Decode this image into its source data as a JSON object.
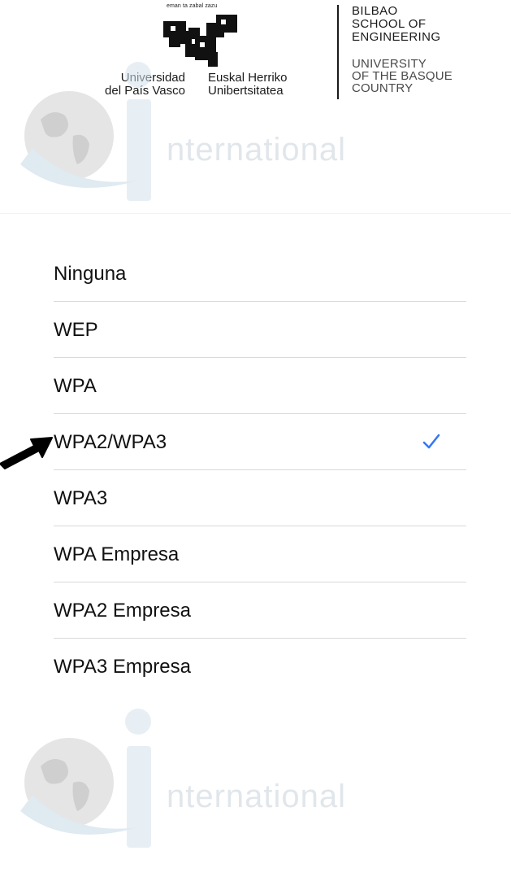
{
  "header": {
    "motto": "eman ta zabal zazu",
    "university_es": [
      "Universidad",
      "del País Vasco"
    ],
    "university_eu": [
      "Euskal Herriko",
      "Unibertsitatea"
    ],
    "school": [
      "BILBAO",
      "SCHOOL OF",
      "ENGINEERING"
    ],
    "university_en": [
      "UNIVERSITY",
      "OF THE BASQUE",
      "COUNTRY"
    ]
  },
  "watermark": {
    "word": "nternational",
    "icon": "globe-icon"
  },
  "security_options": {
    "items": [
      {
        "label": "Ninguna"
      },
      {
        "label": "WEP"
      },
      {
        "label": "WPA"
      },
      {
        "label": "WPA2/WPA3",
        "selected": true
      },
      {
        "label": "WPA3"
      },
      {
        "label": "WPA Empresa"
      },
      {
        "label": "WPA2 Empresa"
      },
      {
        "label": "WPA3 Empresa"
      }
    ],
    "selected_icon": "checkmark-icon",
    "selected_color": "#3478f6"
  },
  "annotation": {
    "icon": "arrow-icon",
    "color": "#000000"
  }
}
